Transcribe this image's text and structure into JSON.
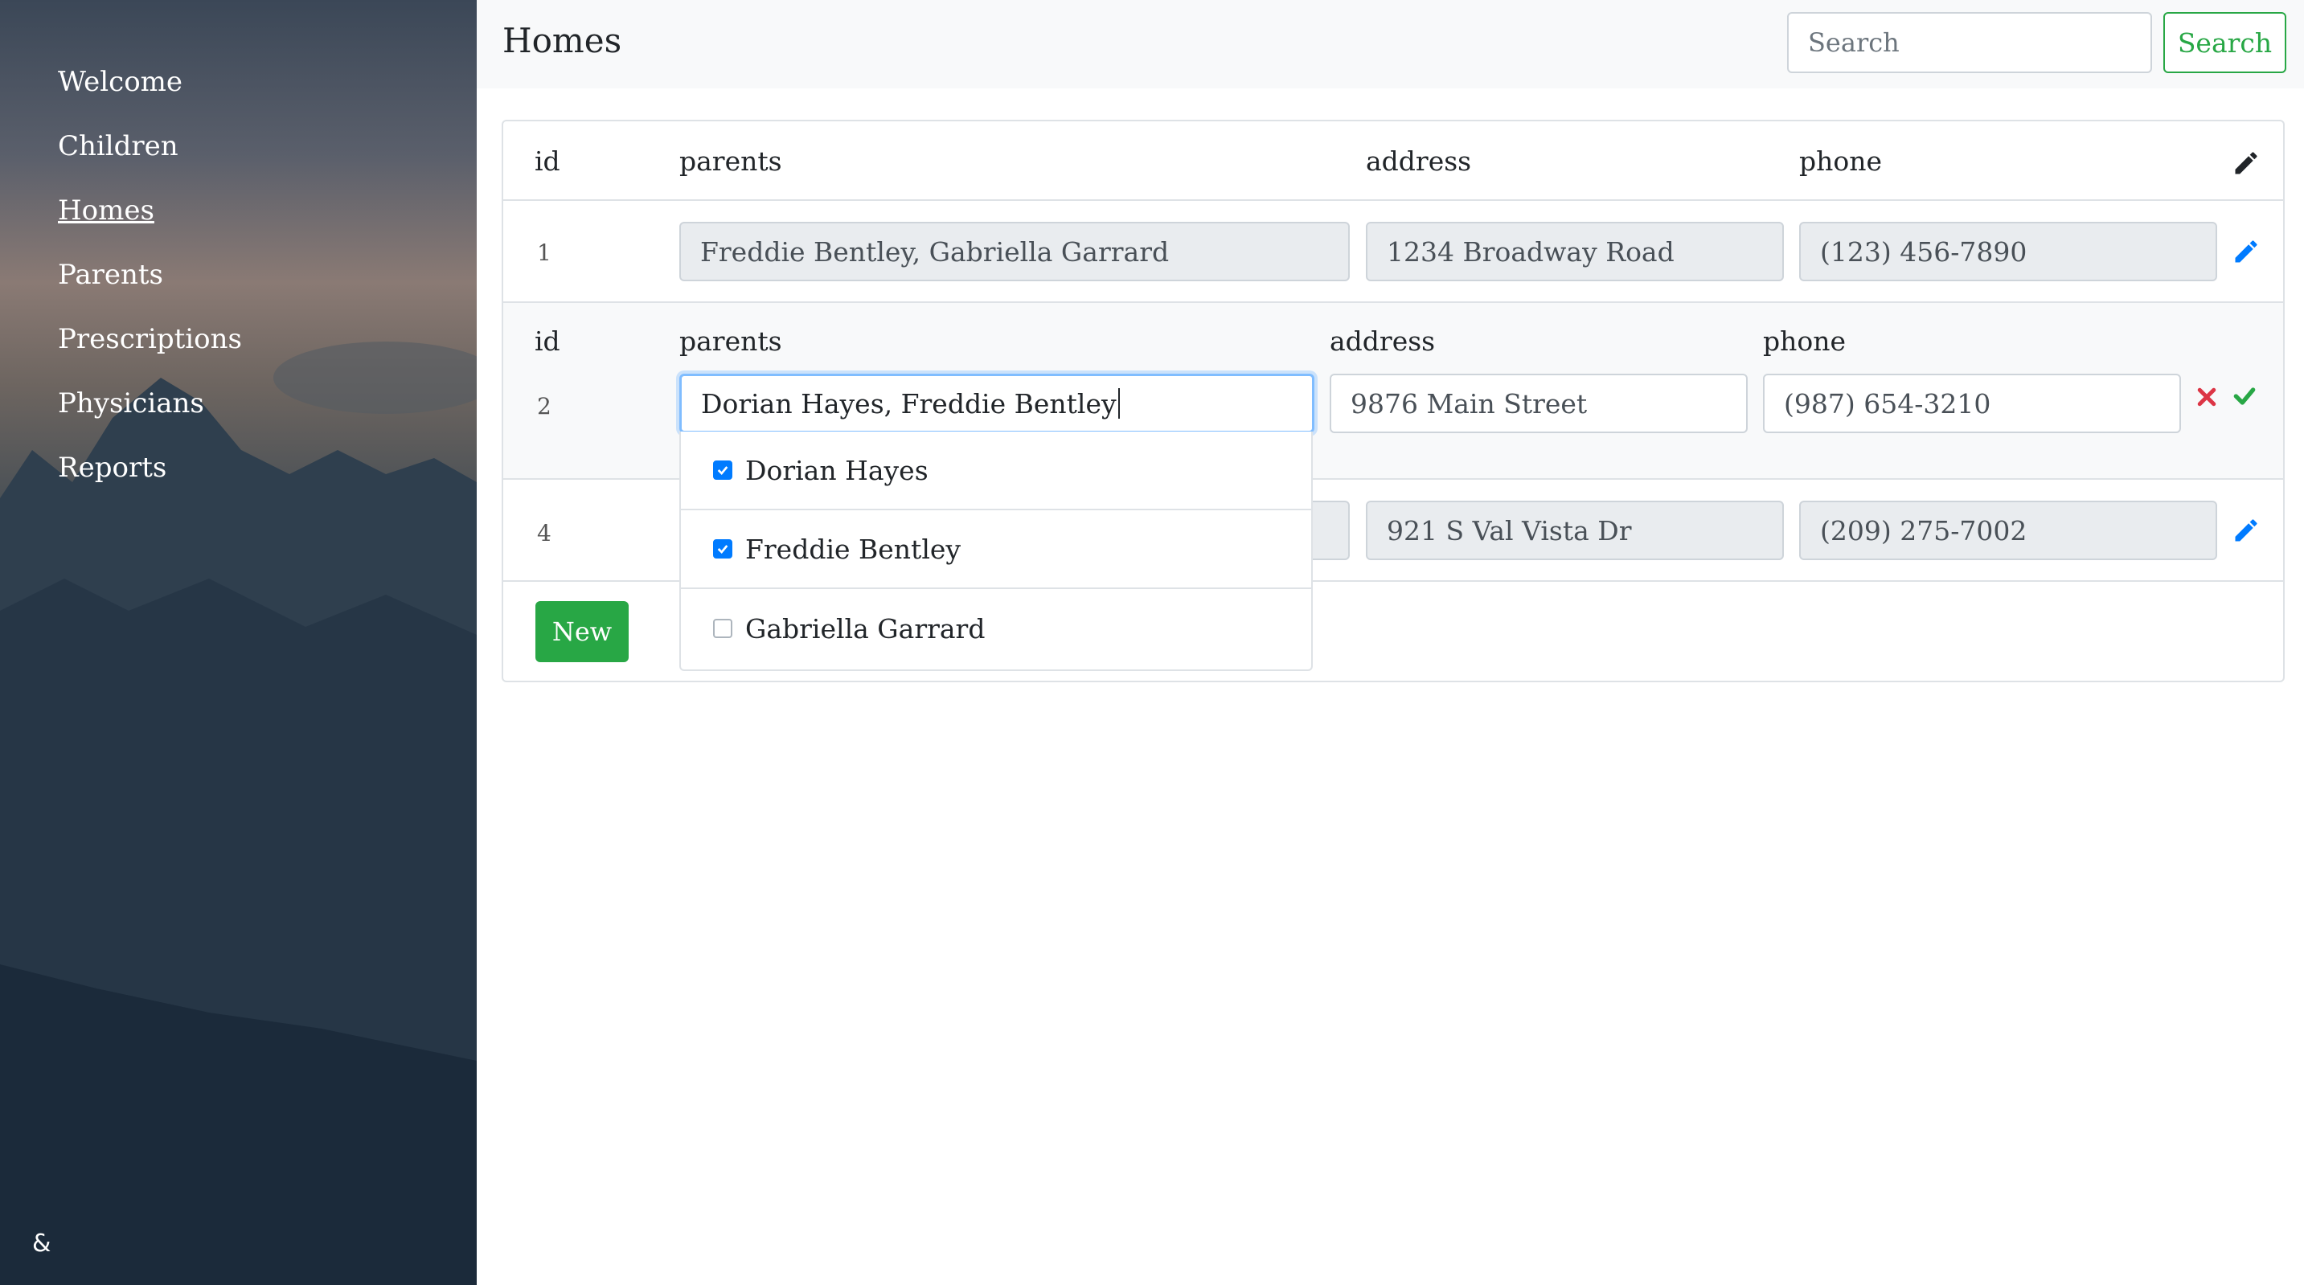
{
  "sidebar": {
    "items": [
      {
        "label": "Welcome"
      },
      {
        "label": "Children"
      },
      {
        "label": "Homes"
      },
      {
        "label": "Parents"
      },
      {
        "label": "Prescriptions"
      },
      {
        "label": "Physicians"
      },
      {
        "label": "Reports"
      }
    ],
    "active_item": "Homes",
    "footer_icon": "ampersand-logo-icon"
  },
  "header": {
    "title": "Homes",
    "search_placeholder": "Search",
    "search_button": "Search"
  },
  "table": {
    "columns": [
      "id",
      "parents",
      "address",
      "phone"
    ],
    "header_icon": "pencil-icon",
    "rows": [
      {
        "id": "1",
        "parents": "Freddie Bentley, Gabriella Garrard",
        "address": "1234 Broadway Road",
        "phone": "(123) 456-7890",
        "mode": "view"
      },
      {
        "id": "2",
        "parents": "Dorian Hayes, Freddie Bentley",
        "address": "9876 Main Street",
        "phone": "(987) 654-3210",
        "mode": "edit"
      },
      {
        "id": "4",
        "parents": "",
        "address": "921 S Val Vista Dr",
        "phone": "(209) 275-7002",
        "mode": "view"
      }
    ],
    "edit_labels": {
      "id": "id",
      "parents": "parents",
      "address": "address",
      "phone": "phone"
    },
    "new_button": "New"
  },
  "parents_dropdown": {
    "options": [
      {
        "label": "Dorian Hayes",
        "checked": true
      },
      {
        "label": "Freddie Bentley",
        "checked": true
      },
      {
        "label": "Gabriella Garrard",
        "checked": false
      }
    ]
  },
  "colors": {
    "success": "#28a745",
    "primary": "#007bff",
    "danger": "#dc3545"
  }
}
